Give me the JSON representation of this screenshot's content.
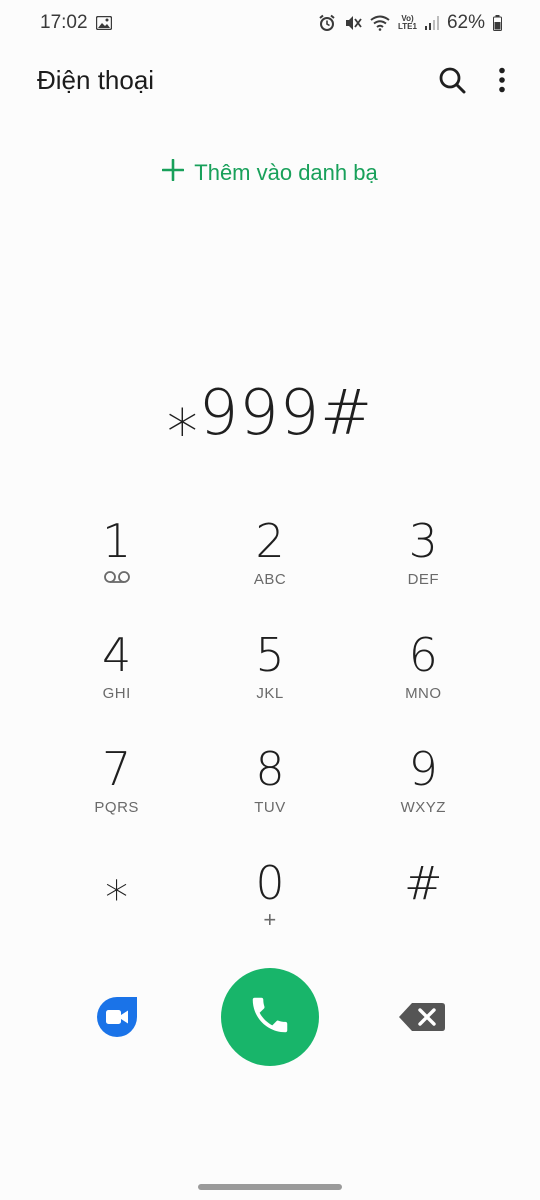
{
  "status_bar": {
    "time": "17:02",
    "volte_label": "Vo)",
    "lte_label": "LTE1",
    "battery_percent": "62%",
    "icons": [
      "gallery-icon",
      "alarm-icon",
      "mute-icon",
      "wifi-icon",
      "signal-icon",
      "battery-icon"
    ]
  },
  "app_bar": {
    "title": "Điện thoại",
    "icons": [
      "search-icon",
      "more-vert-icon"
    ]
  },
  "add_contact": {
    "label": "Thêm vào danh bạ",
    "icon": "plus-icon"
  },
  "dialer": {
    "number": "⁎999#"
  },
  "keypad": {
    "keys": [
      {
        "digit": "1",
        "sub": ""
      },
      {
        "digit": "2",
        "sub": "ABC"
      },
      {
        "digit": "3",
        "sub": "DEF"
      },
      {
        "digit": "4",
        "sub": "GHI"
      },
      {
        "digit": "5",
        "sub": "JKL"
      },
      {
        "digit": "6",
        "sub": "MNO"
      },
      {
        "digit": "7",
        "sub": "PQRS"
      },
      {
        "digit": "8",
        "sub": "TUV"
      },
      {
        "digit": "9",
        "sub": "WXYZ"
      },
      {
        "digit": "⁎",
        "sub": ""
      },
      {
        "digit": "0",
        "sub": "+"
      },
      {
        "digit": "#",
        "sub": ""
      }
    ]
  },
  "actions": {
    "icons": [
      "video-call-icon",
      "call-icon",
      "backspace-icon"
    ]
  },
  "colors": {
    "accent": "#18a05a",
    "call_button": "#18b56a",
    "video_button": "#1a73e8",
    "backspace": "#555555"
  }
}
